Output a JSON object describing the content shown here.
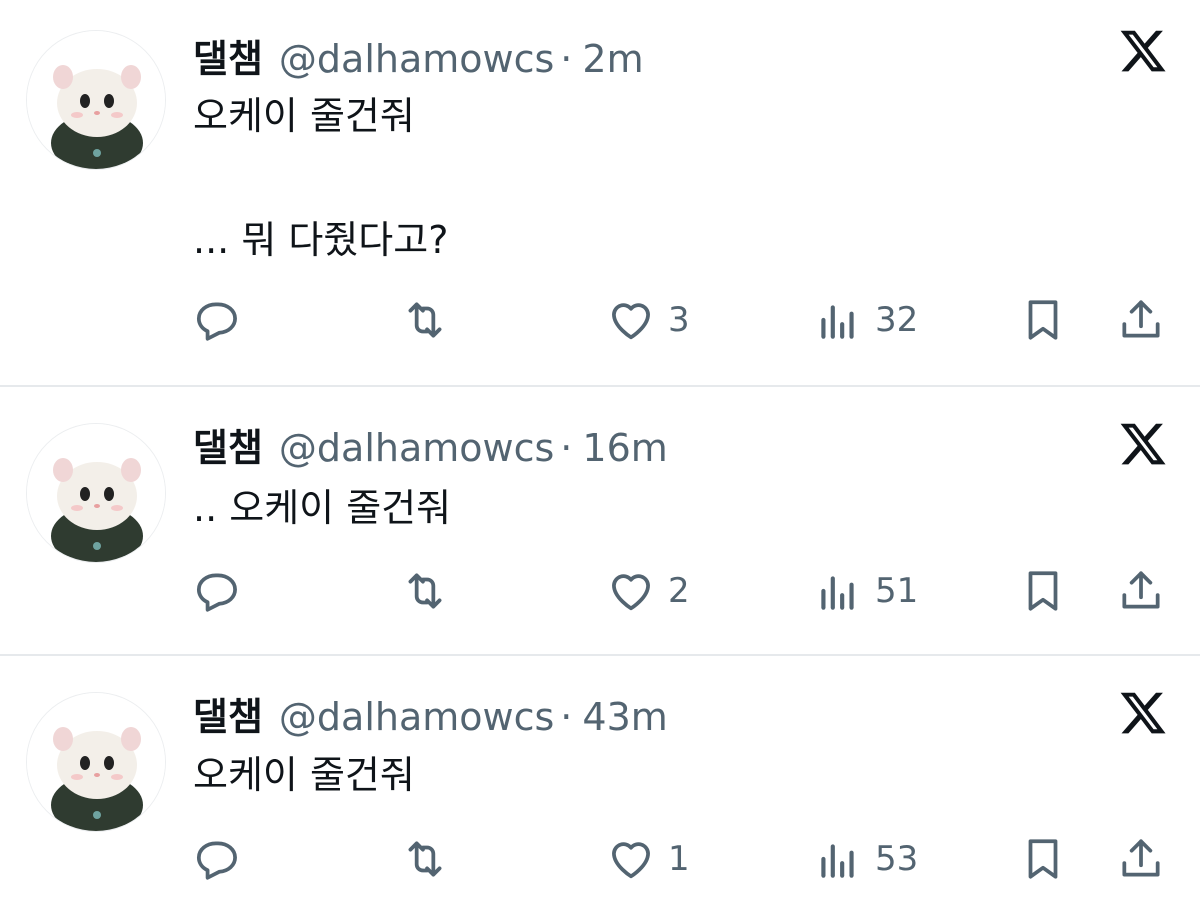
{
  "tweets": [
    {
      "display_name": "댈챔",
      "handle": "@dalhamowcs",
      "separator": "·",
      "time": "2m",
      "text": "오케이 줄건줘\n\n... 뭐 다줬다고?",
      "likes": "3",
      "views": "32"
    },
    {
      "display_name": "댈챔",
      "handle": "@dalhamowcs",
      "separator": "·",
      "time": "16m",
      "text": ".. 오케이 줄건줘",
      "likes": "2",
      "views": "51"
    },
    {
      "display_name": "댈챔",
      "handle": "@dalhamowcs",
      "separator": "·",
      "time": "43m",
      "text": "오케이 줄건줘",
      "likes": "1",
      "views": "53"
    }
  ],
  "icons": {
    "brand": "x-logo-icon",
    "reply": "reply-icon",
    "repost": "repost-icon",
    "like": "heart-icon",
    "views": "views-icon",
    "bookmark": "bookmark-icon",
    "share": "share-icon"
  },
  "colors": {
    "text": "#0f1419",
    "secondary": "#536471",
    "divider": "#e6e9ec",
    "avatar_outfit": "#2f3b30"
  }
}
